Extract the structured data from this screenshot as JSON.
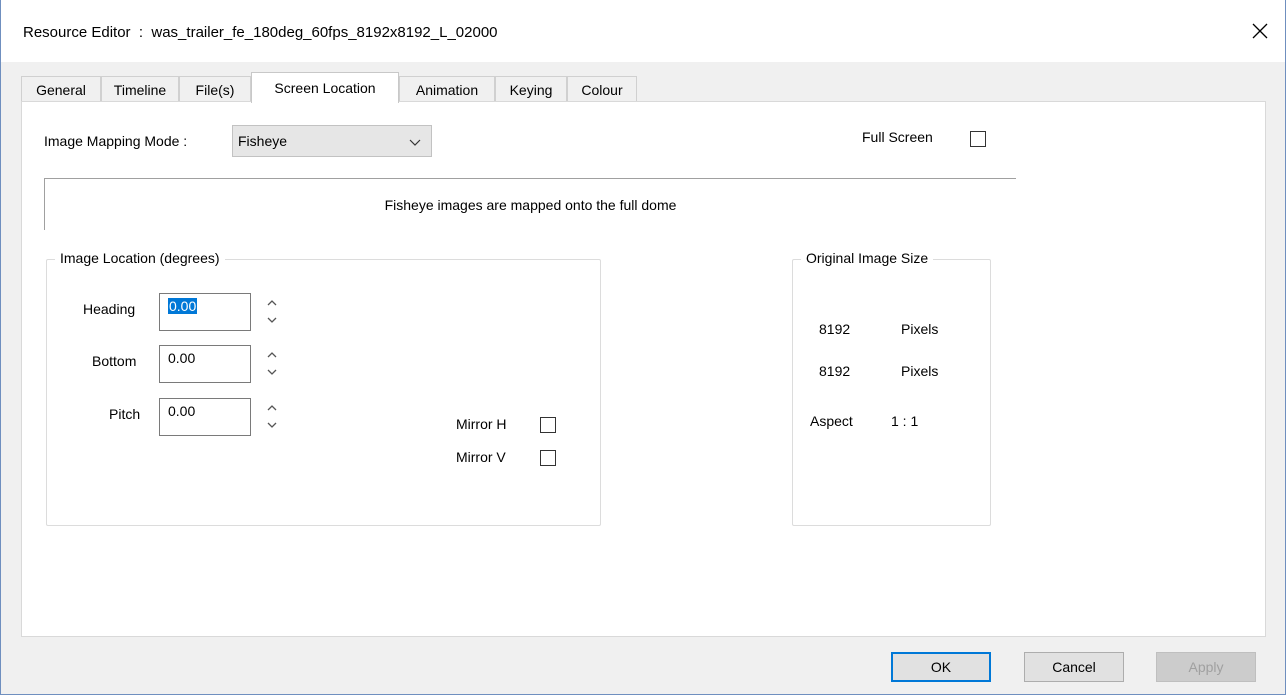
{
  "window": {
    "title": "Resource Editor  :  was_trailer_fe_180deg_60fps_8192x8192_L_02000",
    "close_icon": "close-icon"
  },
  "tabs": [
    {
      "label": "General"
    },
    {
      "label": "Timeline"
    },
    {
      "label": "File(s)"
    },
    {
      "label": "Screen Location",
      "active": true
    },
    {
      "label": "Animation"
    },
    {
      "label": "Keying"
    },
    {
      "label": "Colour"
    }
  ],
  "mapping": {
    "label": "Image Mapping Mode :",
    "selected": "Fisheye",
    "description": "Fisheye images are mapped onto the full dome"
  },
  "full_screen": {
    "label": "Full Screen",
    "checked": false
  },
  "image_location": {
    "title": "Image Location (degrees)",
    "heading": {
      "label": "Heading",
      "value": "0.00"
    },
    "bottom": {
      "label": "Bottom",
      "value": "0.00"
    },
    "pitch": {
      "label": "Pitch",
      "value": "0.00"
    },
    "mirror_h": {
      "label": "Mirror H",
      "checked": false
    },
    "mirror_v": {
      "label": "Mirror V",
      "checked": false
    }
  },
  "original_size": {
    "title": "Original Image Size",
    "width_value": "8192",
    "width_unit": "Pixels",
    "height_value": "8192",
    "height_unit": "Pixels",
    "aspect_label": "Aspect",
    "aspect_value": "1 : 1"
  },
  "buttons": {
    "ok": "OK",
    "cancel": "Cancel",
    "apply": "Apply"
  },
  "colors": {
    "accent": "#0078d7",
    "panel_bg": "#ffffff",
    "window_bg": "#f0f0f0"
  }
}
